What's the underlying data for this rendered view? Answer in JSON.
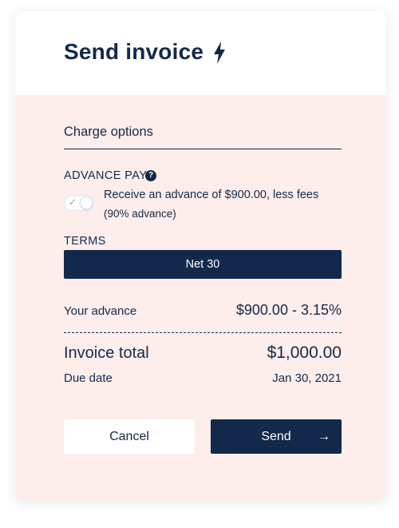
{
  "header": {
    "title": "Send invoice",
    "title_icon": "lightning-bolt-icon"
  },
  "charge_options": {
    "section_title": "Charge options",
    "advance_pay": {
      "label": "ADVANCE PAY",
      "help_icon": "?",
      "toggle_on": false,
      "description": "Receive an advance of $900.00, less fees",
      "sub_description": "(90% advance)"
    },
    "terms": {
      "label": "TERMS",
      "selected": "Net 30"
    }
  },
  "summary": {
    "your_advance_label": "Your advance",
    "your_advance_value": "$900.00 - 3.15%",
    "invoice_total_label": "Invoice total",
    "invoice_total_value": "$1,000.00",
    "due_date_label": "Due date",
    "due_date_value": "Jan 30, 2021"
  },
  "actions": {
    "cancel_label": "Cancel",
    "send_label": "Send",
    "send_icon": "→"
  },
  "colors": {
    "navy": "#13294b",
    "panel_bg": "#fdeeeb"
  }
}
